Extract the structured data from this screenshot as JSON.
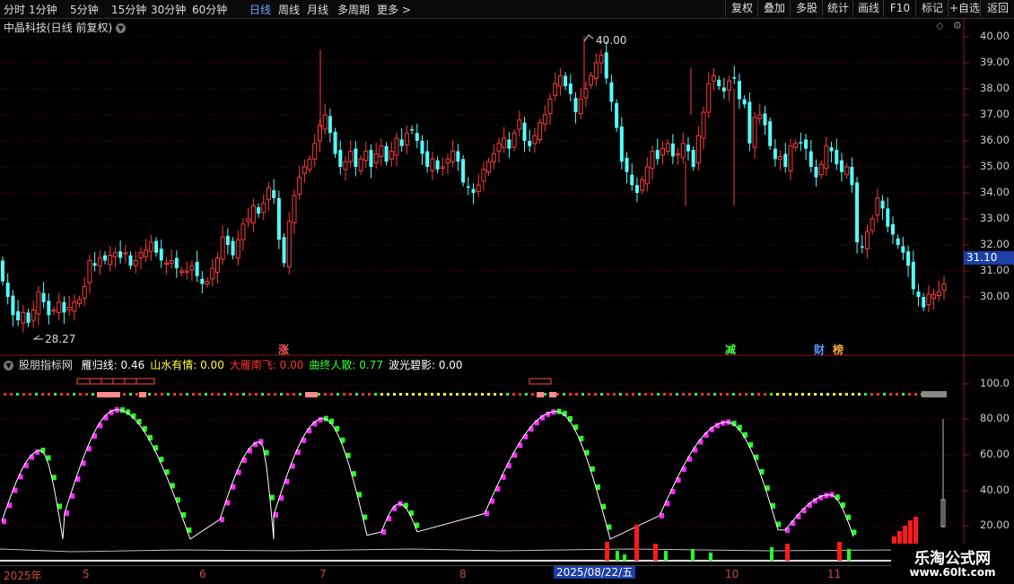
{
  "toolbar": {
    "periods": [
      "分时",
      "1分钟",
      "5分钟",
      "15分钟",
      "30分钟",
      "60分钟",
      "日线",
      "周线",
      "月线",
      "多周期",
      "更多 >"
    ],
    "active_period": "日线",
    "buttons": [
      "复权",
      "叠加",
      "多股",
      "统计",
      "画线",
      "F10",
      "标记",
      "+自选",
      "返回"
    ]
  },
  "stock": {
    "title": "中晶科技(日线 前复权)",
    "high_label": "40.00",
    "low_label": "28.27",
    "last_price": "31.10"
  },
  "price_axis": [
    "40.00",
    "39.00",
    "38.00",
    "37.00",
    "36.00",
    "35.00",
    "34.00",
    "33.00",
    "32.00",
    "31.00",
    "30.00"
  ],
  "markers": {
    "zhang": "涨",
    "jian": "减",
    "cai": "财",
    "bang": "榜"
  },
  "indicator": {
    "name": "股朋指标网",
    "items": [
      {
        "label": "雁归线: 0.46",
        "color": "#ffffff"
      },
      {
        "label": "山水有情: 0.00",
        "color": "#ffff44"
      },
      {
        "label": "大雁南飞: 0.00",
        "color": "#ff3333"
      },
      {
        "label": "曲终人散: 0.77",
        "color": "#33ff33"
      },
      {
        "label": "波光碧影: 0.00",
        "color": "#ffffff"
      }
    ],
    "axis": [
      "100.0",
      "80.00",
      "60.00",
      "40.00",
      "20.00"
    ]
  },
  "dates": [
    "2025年",
    "5",
    "6",
    "7",
    "8",
    "10",
    "11"
  ],
  "current_date": "2025/08/22/五",
  "watermark": {
    "line1": "乐淘公式网",
    "line2": "www.60lt.com"
  },
  "chart_data": {
    "type": "candlestick",
    "title": "中晶科技(日线 前复权)",
    "ylim": [
      28.0,
      40.5
    ],
    "high": 40.0,
    "low": 28.27,
    "last": 31.1,
    "closes": [
      30.6,
      30.0,
      29.3,
      29.1,
      29.4,
      29.0,
      29.5,
      30.2,
      29.8,
      29.3,
      29.5,
      29.8,
      29.4,
      29.6,
      29.8,
      29.9,
      30.4,
      31.4,
      31.2,
      31.5,
      31.4,
      31.6,
      31.7,
      31.5,
      31.7,
      31.2,
      31.4,
      31.7,
      31.8,
      32.1,
      31.7,
      31.4,
      31.3,
      31.4,
      31.1,
      31.0,
      31.0,
      31.2,
      30.8,
      30.5,
      30.6,
      31.1,
      31.5,
      32.3,
      32.0,
      31.6,
      32.2,
      32.8,
      33.0,
      33.5,
      33.2,
      33.6,
      34.2,
      33.8,
      32.2,
      31.3,
      32.9,
      33.9,
      34.6,
      35.0,
      35.3,
      35.9,
      36.6,
      37.0,
      36.3,
      35.5,
      35.0,
      35.2,
      35.6,
      35.0,
      35.3,
      35.6,
      35.0,
      35.5,
      35.8,
      35.2,
      35.6,
      36.1,
      35.8,
      36.3,
      36.4,
      36.0,
      35.5,
      35.0,
      35.3,
      34.9,
      35.0,
      35.3,
      35.6,
      35.2,
      34.4,
      34.2,
      34.0,
      34.3,
      34.9,
      35.2,
      35.5,
      35.9,
      36.1,
      35.7,
      36.3,
      36.8,
      36.0,
      35.8,
      36.2,
      36.7,
      37.0,
      37.6,
      38.2,
      38.5,
      38.1,
      37.8,
      37.1,
      37.6,
      38.0,
      38.5,
      39.0,
      39.3,
      38.4,
      37.5,
      36.5,
      35.2,
      34.8,
      34.3,
      34.0,
      34.5,
      35.0,
      35.6,
      35.3,
      35.7,
      35.9,
      35.4,
      35.5,
      35.9,
      35.6,
      35.0,
      36.2,
      37.1,
      38.2,
      38.5,
      38.1,
      37.9,
      38.3,
      38.4,
      37.6,
      37.4,
      35.9,
      36.9,
      37.0,
      36.6,
      35.8,
      35.3,
      35.4,
      35.0,
      35.8,
      35.9,
      35.9,
      35.7,
      35.0,
      34.6,
      35.1,
      35.8,
      35.6,
      35.1,
      34.8,
      35.0,
      34.3,
      32.1,
      31.9,
      32.5,
      33.0,
      33.8,
      33.4,
      32.7,
      32.4,
      32.0,
      31.7,
      31.2,
      30.3,
      30.0,
      29.6,
      30.1,
      30.1,
      30.2,
      30.5
    ]
  }
}
